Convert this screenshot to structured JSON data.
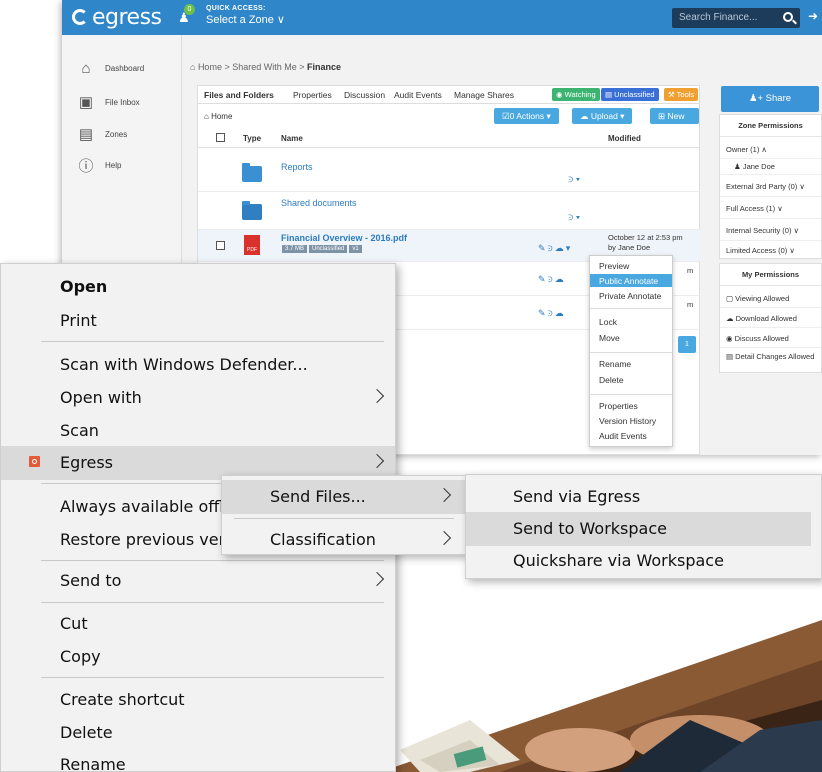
{
  "app": {
    "logo": "egress",
    "quick_access_badge": "0",
    "quick_access_title": "QUICK ACCESS:",
    "quick_access_value": "Select a Zone ∨",
    "search_placeholder": "Search Finance...",
    "sidebar": [
      {
        "icon": "home-icon",
        "label": "Dashboard"
      },
      {
        "icon": "inbox-icon",
        "label": "File Inbox"
      },
      {
        "icon": "briefcase-icon",
        "label": "Zones"
      },
      {
        "icon": "info-icon",
        "label": "Help"
      }
    ],
    "breadcrumb": {
      "path": "Home > Shared With Me > ",
      "current": "Finance"
    },
    "tabs": [
      "Files and Folders",
      "Properties",
      "Discussion",
      "Audit Events",
      "Manage Shares"
    ],
    "tags": {
      "watching": "Watching",
      "unclassified": "Unclassified",
      "tools": "Tools"
    },
    "toolbar": {
      "home": "Home",
      "actions_count": "0",
      "actions": "Actions",
      "upload": "Upload",
      "new": "New"
    },
    "columns": {
      "type": "Type",
      "name": "Name",
      "modified": "Modified"
    },
    "rows": [
      {
        "name": "Reports"
      },
      {
        "name": "Shared documents"
      },
      {
        "name": "Financial Overview - 2016.pdf",
        "size": "3.7 MB",
        "class": "Unclassified",
        "version": "v1",
        "modified": "October 12 at 2:53 pm",
        "by": "by Jane Doe",
        "pdf_label": "PDF"
      }
    ],
    "row_tail_4": "m",
    "row_tail_5": "m",
    "pager": "1",
    "dropdown": [
      "Preview",
      "Public Annotate",
      "Private Annotate",
      "Lock",
      "Move",
      "Rename",
      "Delete",
      "Properties",
      "Version History",
      "Audit Events"
    ],
    "share_button": "Share",
    "zone_permissions": {
      "title": "Zone Permissions",
      "items": [
        "Owner (1) ∧",
        "Jane Doe",
        "External 3rd Party (0) ∨",
        "Full Access (1) ∨",
        "Internal Security (0) ∨",
        "Limited Access (0) ∨"
      ]
    },
    "my_permissions": {
      "title": "My Permissions",
      "items": [
        "Viewing Allowed",
        "Download Allowed",
        "Discuss Allowed",
        "Detail Changes Allowed"
      ]
    }
  },
  "context_menu": {
    "items": [
      "Open",
      "Print",
      "Scan with Windows Defender...",
      "Open with",
      "Scan",
      "Egress",
      "Always available offline",
      "Restore previous versions",
      "Send to",
      "Cut",
      "Copy",
      "Create shortcut",
      "Delete",
      "Rename"
    ],
    "egress_submenu": [
      "Send Files...",
      "Classification"
    ],
    "send_files_submenu": [
      "Send via Egress",
      "Send to Workspace",
      "Quickshare via Workspace"
    ]
  },
  "colors": {
    "brand_blue": "#2f86c9",
    "button_blue": "#4aa8e0",
    "menu_bg": "#f2f2f2",
    "menu_highlight": "#dadada",
    "egress_orange": "#e45b3c"
  }
}
